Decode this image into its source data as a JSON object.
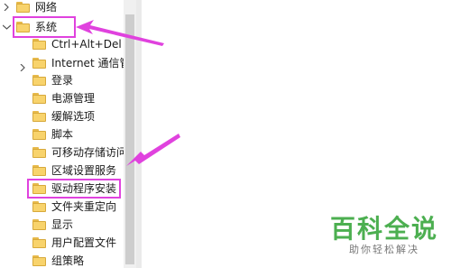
{
  "tree": {
    "items": [
      {
        "label": "网络",
        "chevron": ">",
        "expanded": false
      },
      {
        "label": "系统",
        "chevron": "v",
        "expanded": true,
        "highlighted": true
      },
      {
        "label": "Ctrl+Alt+Del",
        "chevron": ""
      },
      {
        "label": "Internet 通信管",
        "chevron": ">"
      },
      {
        "label": "登录",
        "chevron": ""
      },
      {
        "label": "电源管理",
        "chevron": ""
      },
      {
        "label": "缓解选项",
        "chevron": ""
      },
      {
        "label": "脚本",
        "chevron": ""
      },
      {
        "label": "可移动存储访问",
        "chevron": ""
      },
      {
        "label": "区域设置服务",
        "chevron": ""
      },
      {
        "label": "驱动程序安装",
        "chevron": "",
        "highlighted": true
      },
      {
        "label": "文件夹重定向",
        "chevron": ""
      },
      {
        "label": "显示",
        "chevron": ""
      },
      {
        "label": "用户配置文件",
        "chevron": ""
      },
      {
        "label": "组策略",
        "chevron": ""
      }
    ]
  },
  "annotations": {
    "color": "#e042de",
    "arrows": 2
  },
  "watermark": {
    "title": "百科全说",
    "subtitle": "助你轻松解决",
    "color": "#4caf50"
  }
}
